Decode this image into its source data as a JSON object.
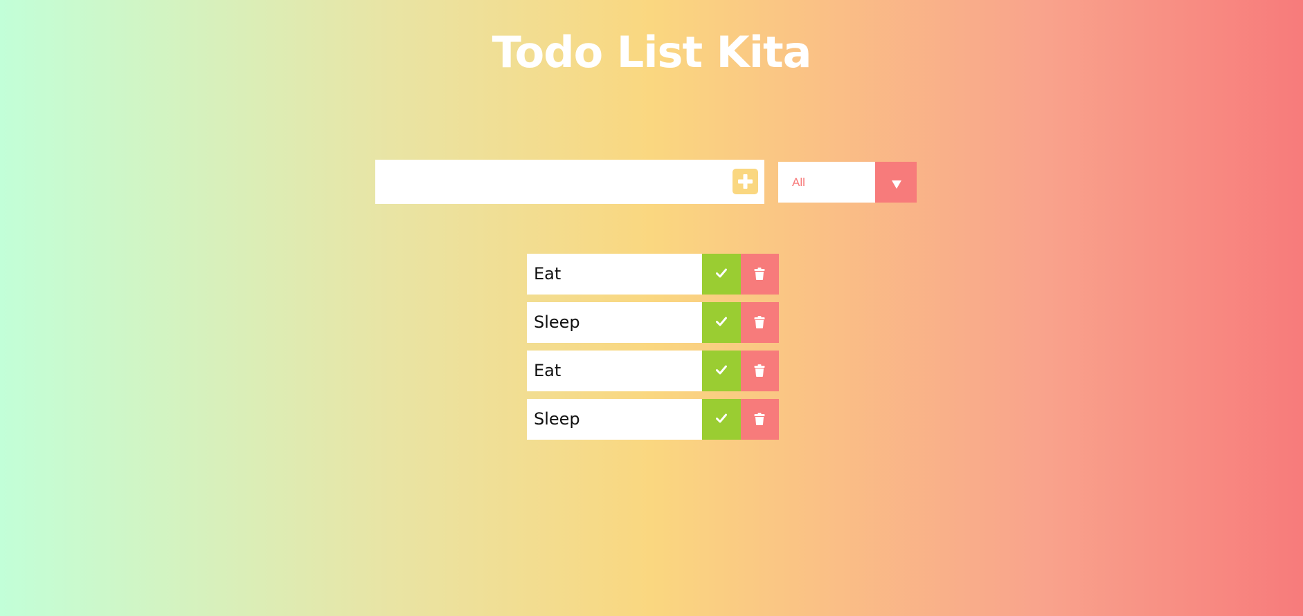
{
  "header": {
    "title": "Todo List Kita"
  },
  "add_form": {
    "input_value": "",
    "add_icon": "plus-icon"
  },
  "filter": {
    "selected": "All",
    "arrow_icon": "caret-down-icon"
  },
  "todos": [
    {
      "text": "Eat",
      "complete_icon": "check-icon",
      "delete_icon": "trash-icon"
    },
    {
      "text": "Sleep",
      "complete_icon": "check-icon",
      "delete_icon": "trash-icon"
    },
    {
      "text": "Eat",
      "complete_icon": "check-icon",
      "delete_icon": "trash-icon"
    },
    {
      "text": "Sleep",
      "complete_icon": "check-icon",
      "delete_icon": "trash-icon"
    }
  ],
  "colors": {
    "accent_yellow": "#fad780",
    "accent_red": "#f77b7b",
    "complete_green": "#9acd32",
    "gradient_start": "#c2ffd8",
    "gradient_end": "#f77b7b"
  }
}
